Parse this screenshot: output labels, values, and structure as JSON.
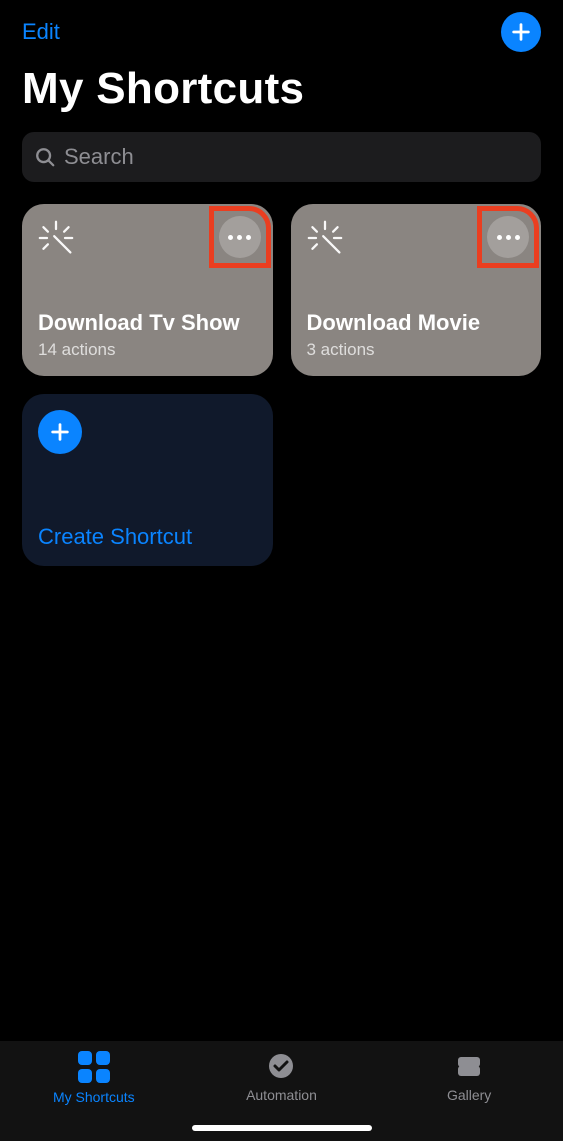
{
  "header": {
    "edit_label": "Edit",
    "page_title": "My Shortcuts"
  },
  "search": {
    "placeholder": "Search"
  },
  "shortcuts": [
    {
      "title": "Download Tv Show",
      "subtitle": "14 actions"
    },
    {
      "title": "Download Movie",
      "subtitle": "3 actions"
    }
  ],
  "create_card": {
    "label": "Create Shortcut"
  },
  "tabs": {
    "my_shortcuts": "My Shortcuts",
    "automation": "Automation",
    "gallery": "Gallery"
  }
}
